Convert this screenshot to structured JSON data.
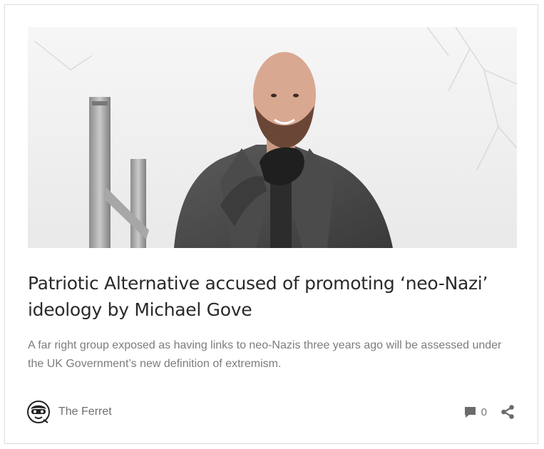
{
  "article": {
    "image_alt": "Man with beard in grey coat smiling outdoors near metal poles",
    "title": "Patriotic Alternative accused of promoting ‘neo-Nazi’ ideology by Michael Gove",
    "excerpt": "A far right group exposed as having links to neo-Nazis three years ago will be assessed under the UK Government’s new definition of extremism."
  },
  "author": {
    "name": "The Ferret",
    "logo_icon": "ferret-logo-icon"
  },
  "meta": {
    "comment_icon": "comment-icon",
    "comment_count": "0",
    "share_icon": "share-icon"
  },
  "colors": {
    "title": "#2a2a2a",
    "excerpt": "#7c7c7c",
    "icon": "#6b6b6b",
    "border": "#dcdcdc"
  }
}
